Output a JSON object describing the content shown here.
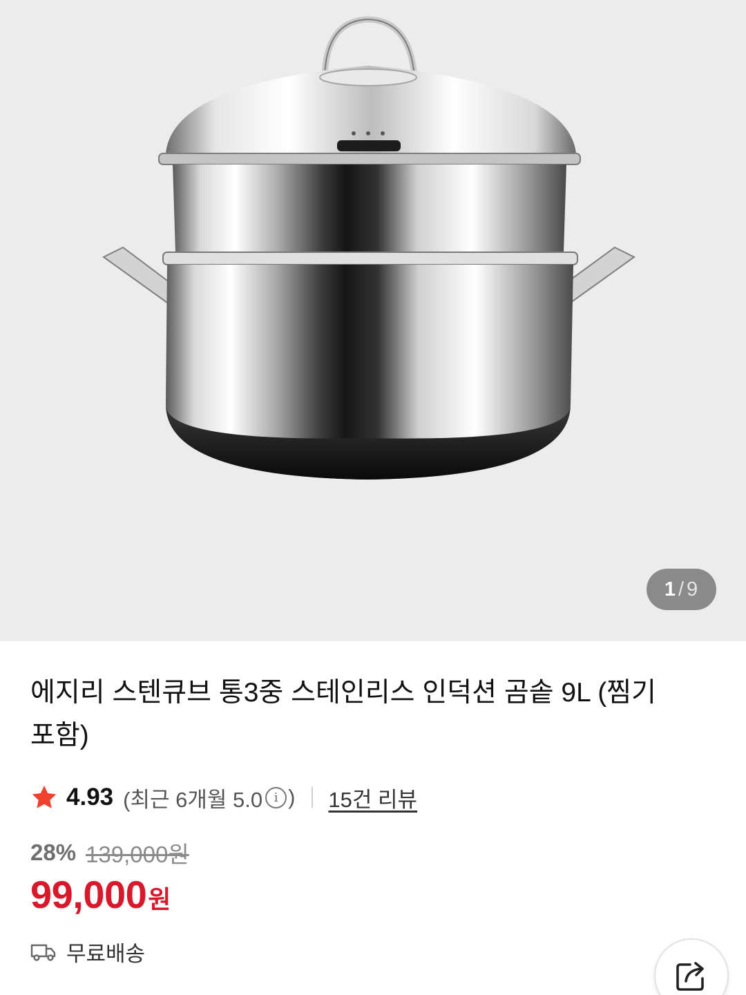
{
  "gallery": {
    "current": "1",
    "separator": "/",
    "total": "9",
    "image_subject": "stainless-steamer-pot"
  },
  "product": {
    "title": "에지리 스텐큐브 통3중 스테인리스 인덕션 곰솥 9L (찜기 포함)"
  },
  "rating": {
    "star_icon": "star-icon",
    "score": "4.93",
    "recent_label": "(최근 6개월 5.0",
    "recent_close": ")",
    "info_icon_glyph": "i",
    "reviews_link": "15건 리뷰"
  },
  "pricing": {
    "discount_rate": "28%",
    "original_price": "139,000원",
    "sale_price": "99,000",
    "currency": "원"
  },
  "shipping": {
    "icon": "truck-icon",
    "label": "무료배송"
  },
  "share": {
    "icon": "share-icon"
  },
  "colors": {
    "accent_red": "#d9192b",
    "star_red": "#f0412e",
    "hero_background": "#ececec"
  }
}
